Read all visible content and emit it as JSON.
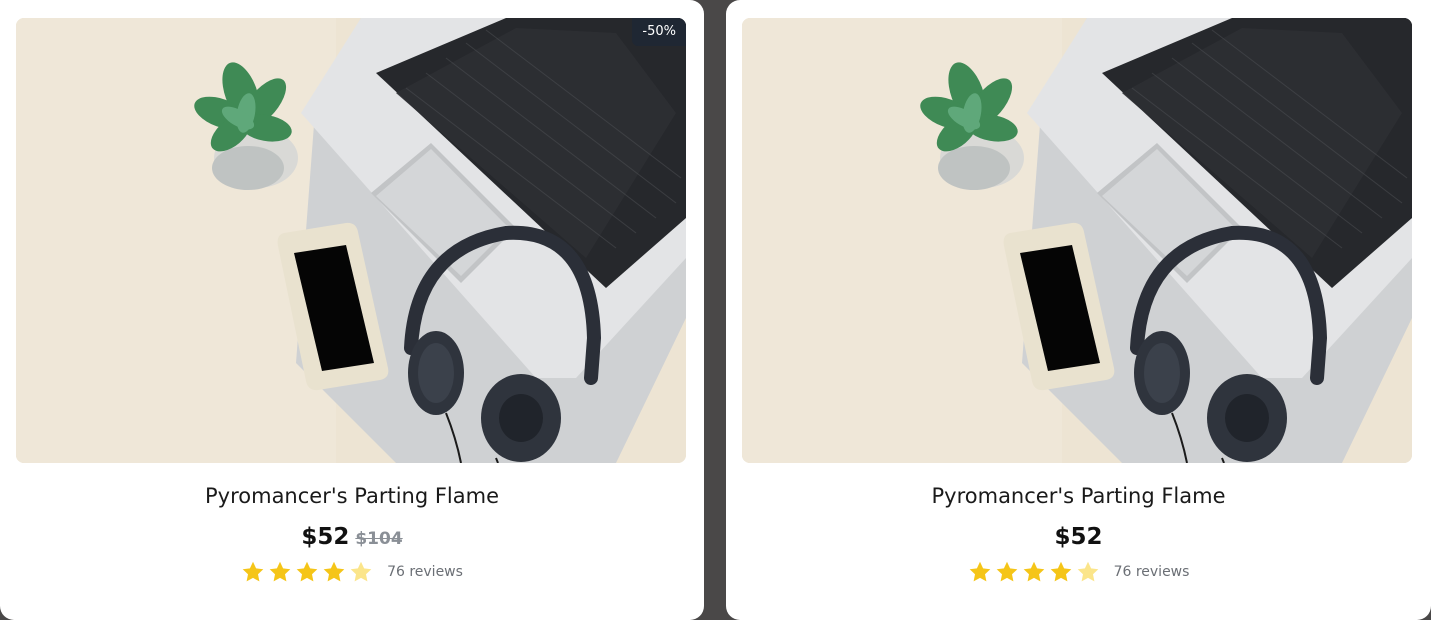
{
  "products": [
    {
      "name": "Pyromancer's Parting Flame",
      "price": "$52",
      "original_price": "$104",
      "discount_badge": "-50%",
      "rating": 4.5,
      "stars": [
        "full",
        "full",
        "full",
        "full",
        "half"
      ],
      "reviews": "76 reviews"
    },
    {
      "name": "Pyromancer's Parting Flame",
      "price": "$52",
      "rating": 4.5,
      "stars": [
        "full",
        "full",
        "full",
        "full",
        "half"
      ],
      "reviews": "76 reviews"
    }
  ],
  "colors": {
    "star_full": "#f5c518",
    "star_half": "#fbe58a",
    "badge_bg": "#1f2733",
    "page_bg": "#4a4848"
  },
  "image": {
    "subject": "desk-flatlay-laptop-phone-headphones-succulent",
    "alt": "Laptop, smartphone, headphones and succulent on a beige desk"
  }
}
